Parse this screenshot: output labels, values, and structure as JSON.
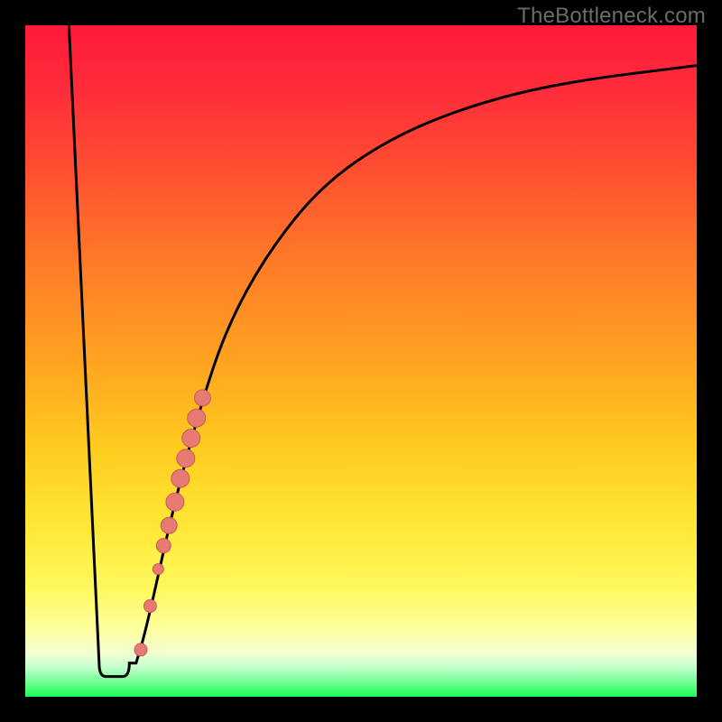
{
  "watermark": "TheBottleneck.com",
  "colors": {
    "background": "#000000",
    "gradient_stops": [
      {
        "offset": 0.0,
        "color": "#ff1a3a"
      },
      {
        "offset": 0.1,
        "color": "#ff2d3a"
      },
      {
        "offset": 0.22,
        "color": "#ff5030"
      },
      {
        "offset": 0.35,
        "color": "#ff7a28"
      },
      {
        "offset": 0.5,
        "color": "#ffa321"
      },
      {
        "offset": 0.62,
        "color": "#ffc91e"
      },
      {
        "offset": 0.74,
        "color": "#ffe634"
      },
      {
        "offset": 0.84,
        "color": "#fff95e"
      },
      {
        "offset": 0.9,
        "color": "#fdffa0"
      },
      {
        "offset": 0.935,
        "color": "#f2ffd2"
      },
      {
        "offset": 0.955,
        "color": "#c8ffce"
      },
      {
        "offset": 0.975,
        "color": "#7dff9c"
      },
      {
        "offset": 1.0,
        "color": "#1aff58"
      }
    ],
    "curve": "#000000",
    "dot_fill": "#e77b74",
    "dot_stroke": "#c95a55"
  },
  "chart_data": {
    "type": "line",
    "title": "",
    "xlabel": "",
    "ylabel": "",
    "xlim": [
      0,
      100
    ],
    "ylim": [
      0,
      100
    ],
    "series": [
      {
        "name": "bottleneck-curve",
        "x": [
          6.5,
          10.5,
          12.5,
          14.5,
          16.5,
          18.0,
          22.0,
          26.0,
          30.0,
          36.0,
          44.0,
          54.0,
          66.0,
          80.0,
          100.0
        ],
        "y": [
          100.0,
          5.5,
          3.0,
          3.0,
          5.0,
          10.0,
          28.0,
          43.0,
          55.0,
          66.0,
          76.0,
          83.0,
          88.0,
          91.5,
          94.0
        ]
      }
    ],
    "flat_bottom": {
      "x_start": 11.0,
      "x_end": 15.5,
      "y": 3.0
    },
    "dots": {
      "name": "highlight-points",
      "points": [
        {
          "x": 17.2,
          "y": 7.0,
          "r": 7
        },
        {
          "x": 18.6,
          "y": 13.5,
          "r": 7
        },
        {
          "x": 19.8,
          "y": 19.0,
          "r": 6
        },
        {
          "x": 20.6,
          "y": 22.5,
          "r": 8
        },
        {
          "x": 21.4,
          "y": 25.5,
          "r": 9
        },
        {
          "x": 22.3,
          "y": 29.0,
          "r": 10
        },
        {
          "x": 23.1,
          "y": 32.5,
          "r": 10
        },
        {
          "x": 23.9,
          "y": 35.5,
          "r": 10
        },
        {
          "x": 24.7,
          "y": 38.5,
          "r": 10
        },
        {
          "x": 25.5,
          "y": 41.5,
          "r": 10
        },
        {
          "x": 26.4,
          "y": 44.5,
          "r": 9
        }
      ]
    }
  }
}
